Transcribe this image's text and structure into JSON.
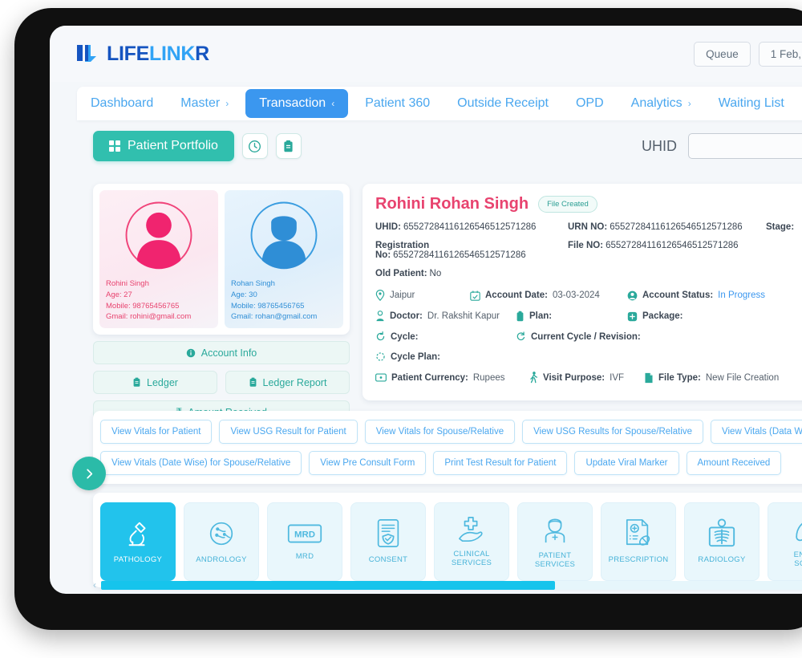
{
  "header": {
    "logo_part1": "LIFE",
    "logo_part2": "LINK",
    "logo_part3": "R",
    "buttons": [
      {
        "label": "Queue",
        "name": "queue-button"
      },
      {
        "label": "1 Feb,",
        "name": "date-button"
      }
    ]
  },
  "nav": {
    "items": [
      {
        "label": "Dashboard",
        "caret": "",
        "active": false
      },
      {
        "label": "Master",
        "caret": "›",
        "active": false
      },
      {
        "label": "Transaction",
        "caret": "‹",
        "active": true
      },
      {
        "label": "Patient 360",
        "caret": "",
        "active": false
      },
      {
        "label": "Outside Receipt",
        "caret": "",
        "active": false
      },
      {
        "label": "OPD",
        "caret": "",
        "active": false
      },
      {
        "label": "Analytics",
        "caret": "›",
        "active": false
      },
      {
        "label": "Waiting List",
        "caret": "",
        "active": false
      }
    ]
  },
  "toolbar": {
    "portfolio_label": "Patient Portfolio",
    "uhid_label": "UHID",
    "uhid_value": "",
    "uhid_placeholder": ""
  },
  "profiles": [
    {
      "name": "Rohini Singh",
      "age_label": "Age: 27",
      "mobile_label": "Mobile: 98765456765",
      "gmail_label": "Gmail: rohini@gmail.com",
      "gender": "female"
    },
    {
      "name": "Rohan Singh",
      "age_label": "Age: 30",
      "mobile_label": "Mobile: 98765456765",
      "gmail_label": "Gmail: rohan@gmail.com",
      "gender": "male"
    }
  ],
  "profile_buttons": {
    "account_info": "Account Info",
    "ledger": "Ledger",
    "ledger_report": "Ledger Report",
    "amount_received": "Amount Received"
  },
  "patient": {
    "name": "Rohini Rohan Singh",
    "badge": "File Created",
    "uhid_label": "UHID:",
    "uhid_value": "65527284116126546512571286",
    "urn_label": "URN NO:",
    "urn_value": "65527284116126546512571286",
    "stage_label": "Stage:",
    "stage_value": "",
    "registration_label": "Registration No:",
    "registration_value": "65527284116126546512571286",
    "file_no_label": "File NO:",
    "file_no_value": "65527284116126546512571286",
    "old_patient_label": "Old Patient:",
    "old_patient_value": "No",
    "city": "Jaipur",
    "account_date_label": "Account Date:",
    "account_date_value": "03-03-2024",
    "account_status_label": "Account Status:",
    "account_status_value": "In Progress",
    "doctor_label": "Doctor:",
    "doctor_value": "Dr. Rakshit Kapur",
    "plan_label": "Plan:",
    "plan_value": "",
    "package_label": "Package:",
    "package_value": "",
    "cycle_label": "Cycle:",
    "cycle_value": "",
    "current_cycle_label": "Current Cycle / Revision:",
    "current_cycle_value": "",
    "cycle_plan_label": "Cycle Plan:",
    "cycle_plan_value": "",
    "currency_label": "Patient Currency:",
    "currency_value": "Rupees",
    "visit_purpose_label": "Visit Purpose:",
    "visit_purpose_value": "IVF",
    "file_type_label": "File Type:",
    "file_type_value": "New File Creation"
  },
  "action_buttons": {
    "row1": [
      "View Vitals for Patient",
      "View USG Result for Patient",
      "View Vitals for Spouse/Relative",
      "View USG Results for Spouse/Relative",
      "View Vitals (Data Wise) for Patient"
    ],
    "row2": [
      "View Vitals (Date Wise) for Spouse/Relative",
      "View Pre Consult Form",
      "Print Test Result for Patient",
      "Update Viral Marker",
      "Amount Received"
    ]
  },
  "tiles": [
    {
      "label": "PATHOLOGY",
      "icon": "microscope-icon",
      "active": true
    },
    {
      "label": "ANDROLOGY",
      "icon": "sperm-icon",
      "active": false
    },
    {
      "label": "MRD",
      "icon": "mrd-icon",
      "active": false
    },
    {
      "label": "CONSENT",
      "icon": "consent-shield-icon",
      "active": false
    },
    {
      "label": "CLINICAL\nSERVICES",
      "icon": "hand-cross-icon",
      "active": false
    },
    {
      "label": "PATIENT\nSERVICES",
      "icon": "nurse-icon",
      "active": false
    },
    {
      "label": "PRESCRIPTION",
      "icon": "prescription-icon",
      "active": false
    },
    {
      "label": "RADIOLOGY",
      "icon": "xray-icon",
      "active": false
    },
    {
      "label": "ENDO\nSCAN",
      "icon": "endoscan-icon",
      "active": false
    }
  ],
  "scroll": {
    "thumb_percent": 56
  },
  "colors": {
    "accent_blue": "#3b97ef",
    "teal": "#31bfae",
    "pink": "#e8436f",
    "cyan": "#22c3ec"
  }
}
